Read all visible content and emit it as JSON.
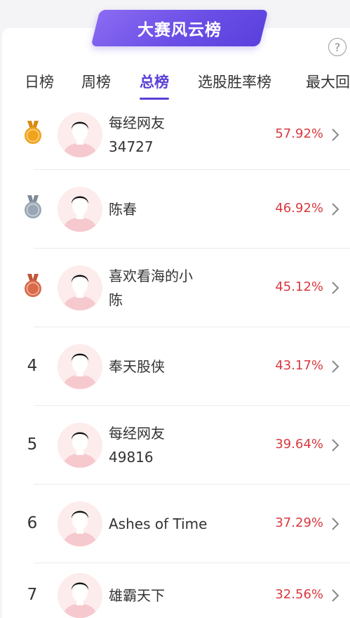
{
  "banner": {
    "title": "大赛风云榜"
  },
  "help": {
    "icon": "question-circle-icon",
    "glyph": "?"
  },
  "tabs": [
    {
      "label": "日榜",
      "active": false
    },
    {
      "label": "周榜",
      "active": false
    },
    {
      "label": "总榜",
      "active": true
    },
    {
      "label": "选股胜率榜",
      "active": false
    },
    {
      "label": "最大回",
      "active": false
    }
  ],
  "colors": {
    "accent": "#5b3fd6",
    "rate": "#d9383e",
    "gold": "#f0a31c",
    "silver": "#9aa6b4",
    "bronze": "#d96a4a"
  },
  "ranking": [
    {
      "rank": "1",
      "medal": "gold",
      "name_lines": [
        "每经网友",
        "34727"
      ],
      "rate": "57.92%"
    },
    {
      "rank": "2",
      "medal": "silver",
      "name_lines": [
        "陈春"
      ],
      "rate": "46.92%"
    },
    {
      "rank": "3",
      "medal": "bronze",
      "name_lines": [
        "喜欢看海的小",
        "陈"
      ],
      "rate": "45.12%"
    },
    {
      "rank": "4",
      "medal": null,
      "name_lines": [
        "奉天股侠"
      ],
      "rate": "43.17%"
    },
    {
      "rank": "5",
      "medal": null,
      "name_lines": [
        "每经网友",
        "49816"
      ],
      "rate": "39.64%"
    },
    {
      "rank": "6",
      "medal": null,
      "name_lines": [
        "Ashes of Time"
      ],
      "rate": "37.29%"
    },
    {
      "rank": "7",
      "medal": null,
      "name_lines": [
        "雄霸天下"
      ],
      "rate": "32.56%"
    }
  ]
}
